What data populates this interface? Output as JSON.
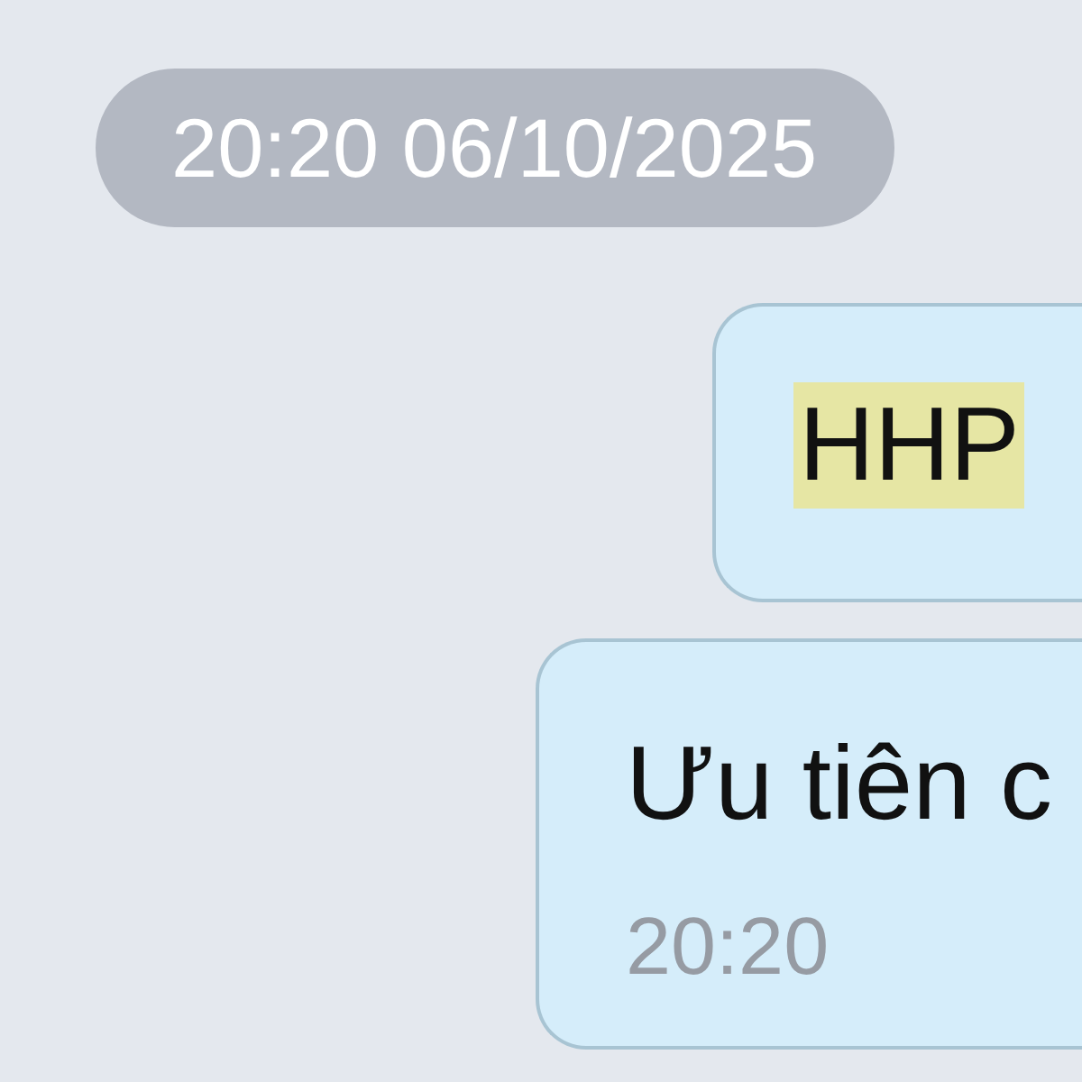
{
  "date_separator": {
    "text": "20:20 06/10/2025"
  },
  "messages": [
    {
      "text": "HHP",
      "highlighted": true
    },
    {
      "text": "Ưu tiên c",
      "highlighted": false,
      "time": "20:20"
    }
  ]
}
